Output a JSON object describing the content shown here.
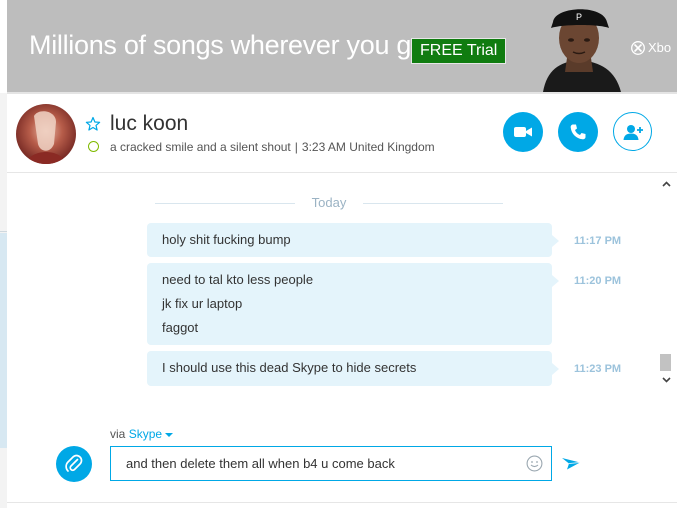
{
  "ad": {
    "headline": "Millions of songs wherever you go.",
    "cta": "FREE Trial",
    "brand": "Xbo"
  },
  "contact": {
    "name": "luc koon",
    "mood": "a cracked smile and a silent shout",
    "time_location": "3:23 AM United Kingdom",
    "status": "online"
  },
  "header_actions": {
    "video": "video-call",
    "call": "audio-call",
    "add": "add-people"
  },
  "conversation": {
    "day_divider": "Today",
    "messages": [
      {
        "lines": [
          "holy shit fucking bump"
        ],
        "time": "11:17 PM"
      },
      {
        "lines": [
          "need to tal kto less people",
          "jk fix ur laptop",
          "faggot"
        ],
        "time": "11:20 PM"
      },
      {
        "lines": [
          "I should use this dead Skype to hide secrets"
        ],
        "time": "11:23 PM"
      }
    ]
  },
  "composer": {
    "via_prefix": "via",
    "via_service": "Skype",
    "draft": "and then delete them all when b4 u come back"
  },
  "colors": {
    "accent": "#00a8e6",
    "bubble": "#e4f4fb",
    "online": "#7fba00",
    "ad_cta": "#107c10"
  }
}
